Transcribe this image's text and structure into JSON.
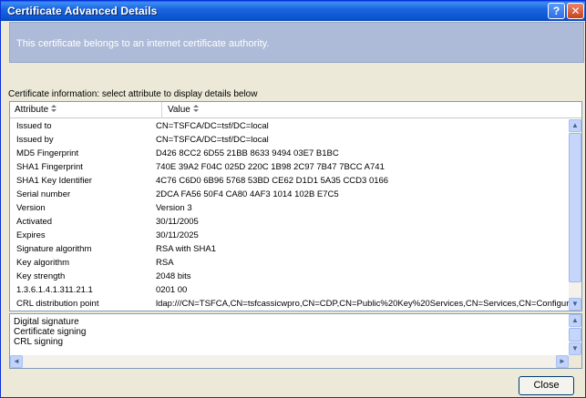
{
  "window": {
    "title": "Certificate Advanced Details",
    "help_label": "?",
    "close_label": "✕"
  },
  "banner": {
    "text": "This certificate belongs to an internet certificate authority."
  },
  "info_label": "Certificate information:  select attribute to display details below",
  "table": {
    "headers": {
      "attribute": "Attribute",
      "value": "Value"
    },
    "rows": [
      {
        "attribute": "Issued to",
        "value": "CN=TSFCA/DC=tsf/DC=local"
      },
      {
        "attribute": "Issued by",
        "value": "CN=TSFCA/DC=tsf/DC=local"
      },
      {
        "attribute": "MD5 Fingerprint",
        "value": "D426 8CC2 6D55 21BB 8633 9494 03E7 B1BC"
      },
      {
        "attribute": "SHA1 Fingerprint",
        "value": "740E 39A2 F04C 025D 220C 1B98 2C97 7B47 7BCC A741"
      },
      {
        "attribute": "SHA1 Key Identifier",
        "value": "4C76 C6D0 6B96 5768 53BD CE62 D1D1 5A35 CCD3 0166"
      },
      {
        "attribute": "Serial number",
        "value": "2DCA FA56 50F4 CA80 4AF3 1014 102B E7C5"
      },
      {
        "attribute": "Version",
        "value": "Version 3"
      },
      {
        "attribute": "Activated",
        "value": "30/11/2005"
      },
      {
        "attribute": "Expires",
        "value": "30/11/2025"
      },
      {
        "attribute": "Signature algorithm",
        "value": "RSA with SHA1"
      },
      {
        "attribute": "Key algorithm",
        "value": "RSA"
      },
      {
        "attribute": "Key strength",
        "value": "2048 bits"
      },
      {
        "attribute": "1.3.6.1.4.1.311.21.1",
        "value": "0201 00"
      },
      {
        "attribute": "CRL distribution point",
        "value": "ldap:///CN=TSFCA,CN=tsfcassicwpro,CN=CDP,CN=Public%20Key%20Services,CN=Services,CN=Configuration"
      }
    ]
  },
  "details": {
    "lines": [
      "Digital signature",
      "Certificate signing",
      "CRL signing"
    ]
  },
  "buttons": {
    "close": "Close"
  },
  "scroll_glyphs": {
    "up": "▲",
    "down": "▼",
    "left": "◄",
    "right": "►"
  }
}
